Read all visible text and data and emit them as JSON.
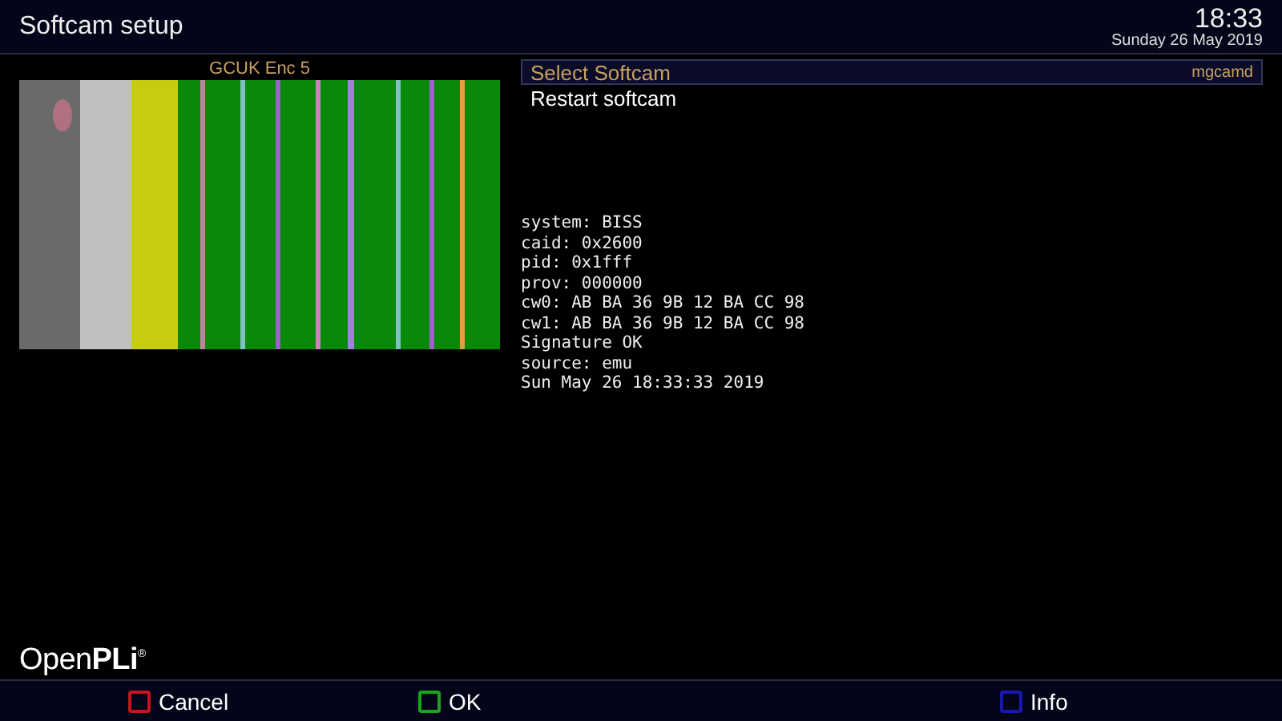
{
  "header": {
    "title": "Softcam setup",
    "time": "18:33",
    "date": "Sunday 26 May 2019"
  },
  "preview": {
    "channel": "GCUK Enc 5"
  },
  "menu": [
    {
      "label": "Select Softcam",
      "value": "mgcamd",
      "selected": true
    },
    {
      "label": "Restart softcam",
      "selected": false
    }
  ],
  "info_lines": [
    "system: BISS",
    "caid: 0x2600",
    "pid: 0x1fff",
    "prov: 000000",
    "cw0: AB BA 36 9B 12 BA CC 98",
    "cw1: AB BA 36 9B 12 BA CC 98",
    "Signature OK",
    "source: emu",
    "Sun May 26 18:33:33 2019"
  ],
  "logo": "Open**PLi**$^{®}$",
  "buttons": [
    {
      "label": "Cancel",
      "color": "#c4161c"
    },
    {
      "label": "OK",
      "color": "#1aa51a"
    },
    {
      "label": "Info",
      "color": "#1818b0"
    }
  ]
}
